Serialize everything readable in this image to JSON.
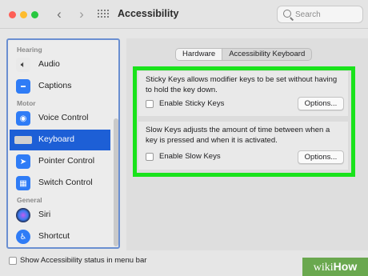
{
  "window": {
    "title": "Accessibility",
    "search_placeholder": "Search"
  },
  "sidebar": {
    "sections": [
      {
        "label": "Hearing"
      },
      {
        "label": "Motor"
      },
      {
        "label": "General"
      }
    ],
    "items": [
      {
        "label": "Audio",
        "icon": "speaker-icon",
        "color": "#e9e9e9"
      },
      {
        "label": "Captions",
        "icon": "captions-icon",
        "color": "#2f7cf6"
      },
      {
        "label": "Voice Control",
        "icon": "voice-control-icon",
        "color": "#2f7cf6"
      },
      {
        "label": "Keyboard",
        "icon": "keyboard-icon",
        "color": "#d0d0d0",
        "selected": true
      },
      {
        "label": "Pointer Control",
        "icon": "pointer-icon",
        "color": "#2f7cf6"
      },
      {
        "label": "Switch Control",
        "icon": "switch-control-icon",
        "color": "#2f7cf6"
      },
      {
        "label": "Siri",
        "icon": "siri-icon",
        "color": "#1a1a2e"
      },
      {
        "label": "Shortcut",
        "icon": "shortcut-icon",
        "color": "#2f7cf6"
      }
    ]
  },
  "tabs": [
    {
      "label": "Hardware",
      "active": true
    },
    {
      "label": "Accessibility Keyboard",
      "active": false
    }
  ],
  "sticky_keys": {
    "description": "Sticky Keys allows modifier keys to be set without having to hold the key down.",
    "checkbox_label": "Enable Sticky Keys",
    "checked": false,
    "options_label": "Options..."
  },
  "slow_keys": {
    "description": "Slow Keys adjusts the amount of time between when a key is pressed and when it is activated.",
    "checkbox_label": "Enable Slow Keys",
    "checked": false,
    "options_label": "Options..."
  },
  "footer": {
    "status_checkbox_label": "Show Accessibility status in menu bar",
    "checked": false
  },
  "watermark": {
    "part1": "wiki",
    "part2": "How"
  },
  "colors": {
    "accent": "#1d5fd6",
    "highlight": "#19e31b"
  }
}
